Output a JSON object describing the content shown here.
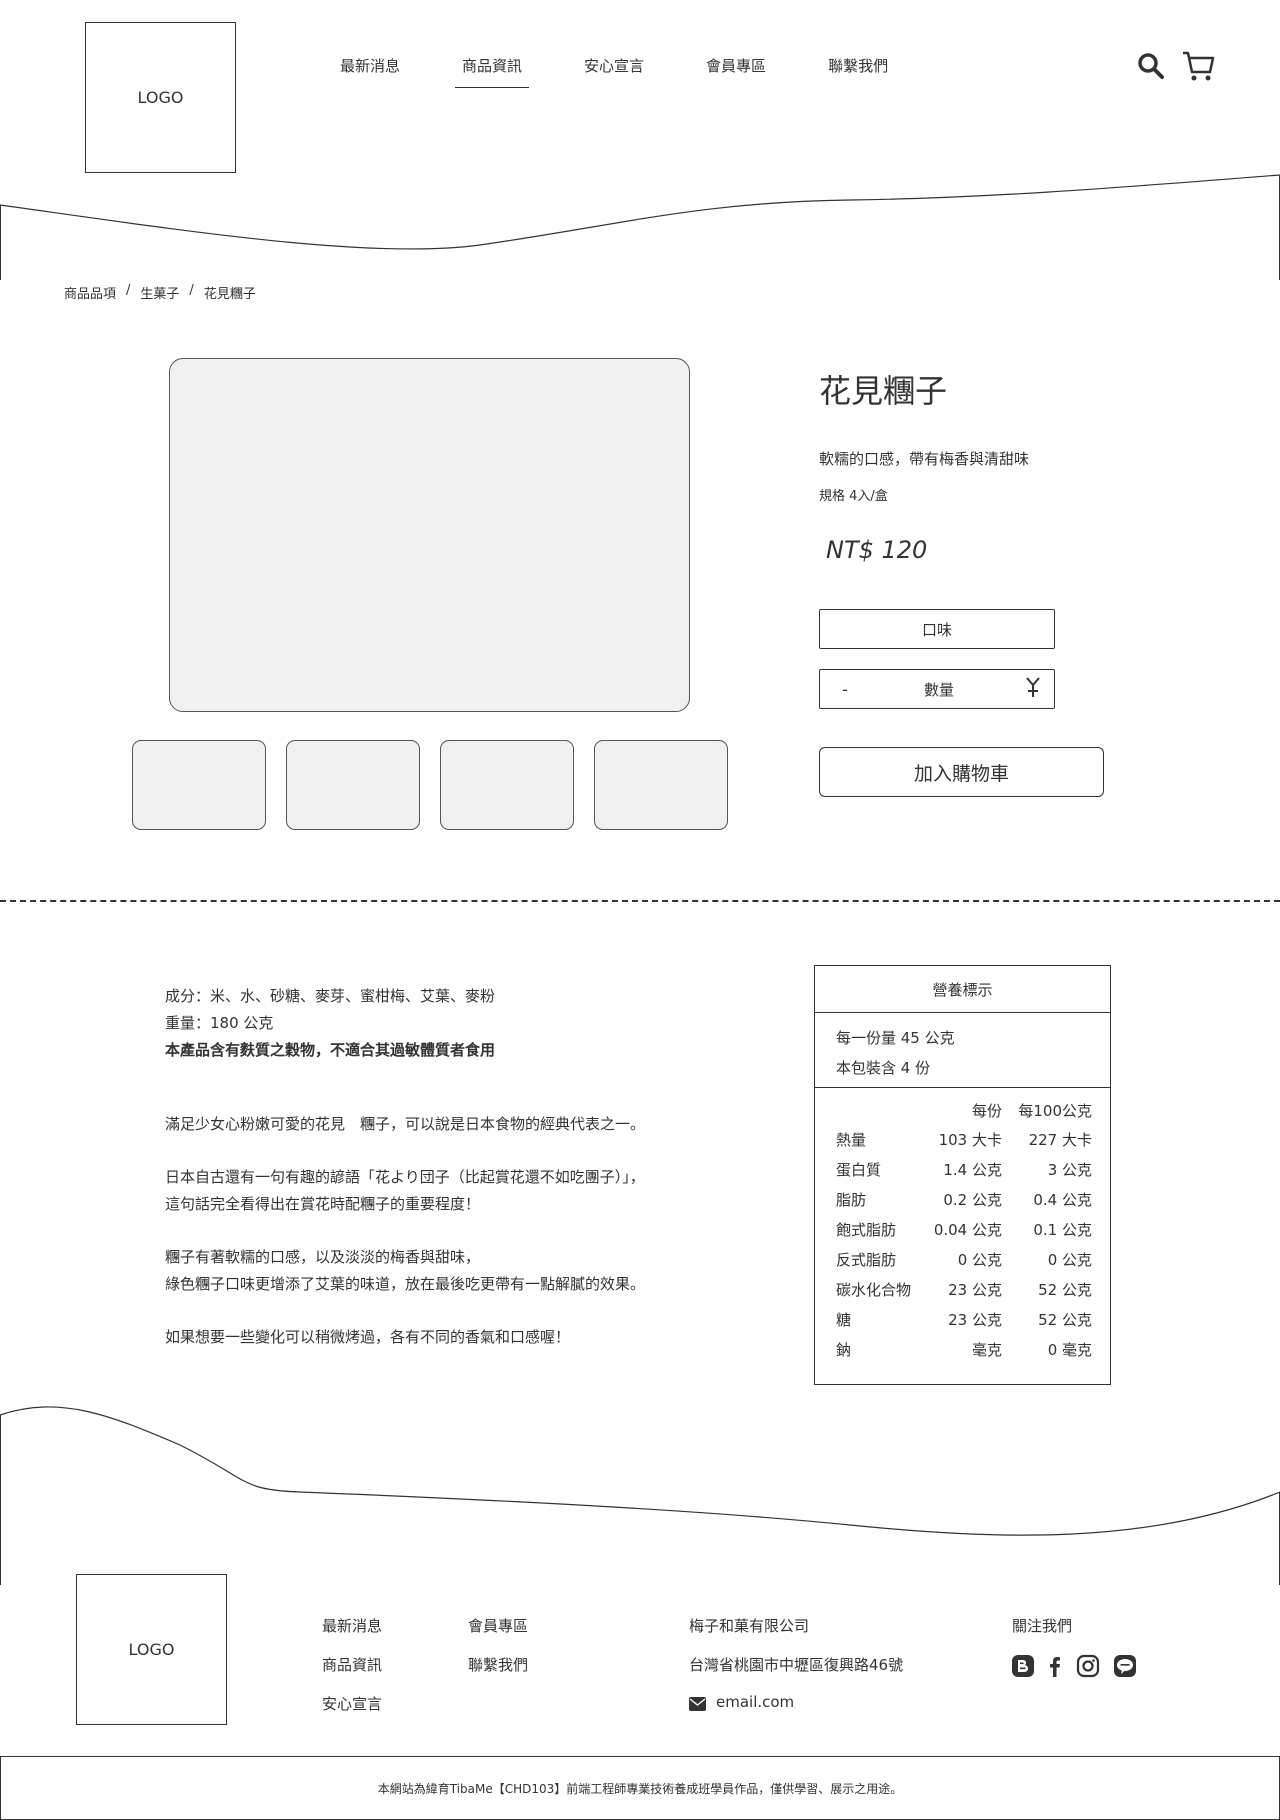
{
  "header": {
    "logo": "LOGO",
    "nav": [
      "最新消息",
      "商品資訊",
      "安心宣言",
      "會員專區",
      "聯繫我們"
    ],
    "active_nav": "商品資訊"
  },
  "breadcrumb": [
    "商品品項",
    "生菓子",
    "花見糰子"
  ],
  "product": {
    "title": "花見糰子",
    "description": "軟糯的口感，帶有梅香與清甜味",
    "spec": "規格 4入/盒",
    "price": "NT$ 120",
    "flavor_label": "口味",
    "qty_minus": "-",
    "qty_label": "數量",
    "add_to_cart": "加入購物車"
  },
  "details": {
    "ingredients": "成分：米、水、砂糖、麥芽、蜜柑梅、艾葉、麥粉",
    "weight": "重量：180 公克",
    "warning": "本產品含有麩質之穀物，不適合其過敏體質者食用",
    "story": [
      "滿足少女心粉嫩可愛的花見　糰子，可以說是日本食物的經典代表之一。",
      "日本自古還有一句有趣的諺語「花より団子（比起賞花還不如吃團子）」，",
      "這句話完全看得出在賞花時配糰子的重要程度！",
      "糰子有著軟糯的口感，以及淡淡的梅香與甜味，",
      "綠色糰子口味更增添了艾葉的味道，放在最後吃更帶有一點解膩的效果。",
      "如果想要一些變化可以稍微烤過，各有不同的香氣和口感喔！"
    ]
  },
  "nutrition": {
    "title": "營養標示",
    "serving_size": "每一份量 45 公克",
    "servings": "本包裝含 4 份",
    "col_per_serving": "每份",
    "col_per_100g": "每100公克",
    "rows": [
      {
        "name": "熱量",
        "per": "103 大卡",
        "per100": "227 大卡"
      },
      {
        "name": "蛋白質",
        "per": "1.4 公克",
        "per100": "3 公克"
      },
      {
        "name": "脂肪",
        "per": "0.2 公克",
        "per100": "0.4 公克"
      },
      {
        "name": "飽式脂肪",
        "per": "0.04 公克",
        "per100": "0.1 公克"
      },
      {
        "name": "反式脂肪",
        "per": "0 公克",
        "per100": "0 公克"
      },
      {
        "name": "碳水化合物",
        "per": "23 公克",
        "per100": "52 公克"
      },
      {
        "name": "糖",
        "per": "23 公克",
        "per100": "52 公克"
      },
      {
        "name": "鈉",
        "per": "毫克",
        "per100": "0 毫克"
      }
    ]
  },
  "footer": {
    "logo": "LOGO",
    "links_col1": [
      "最新消息",
      "商品資訊",
      "安心宣言"
    ],
    "links_col2": [
      "會員專區",
      "聯繫我們"
    ],
    "company": "梅子和菓有限公司",
    "address": "台灣省桃園市中壢區復興路46號",
    "email": "email.com",
    "follow": "關注我們",
    "copyright": "本網站為緯育TibaMe【CHD103】前端工程師專業技術養成班學員作品，僅供學習、展示之用途。"
  }
}
